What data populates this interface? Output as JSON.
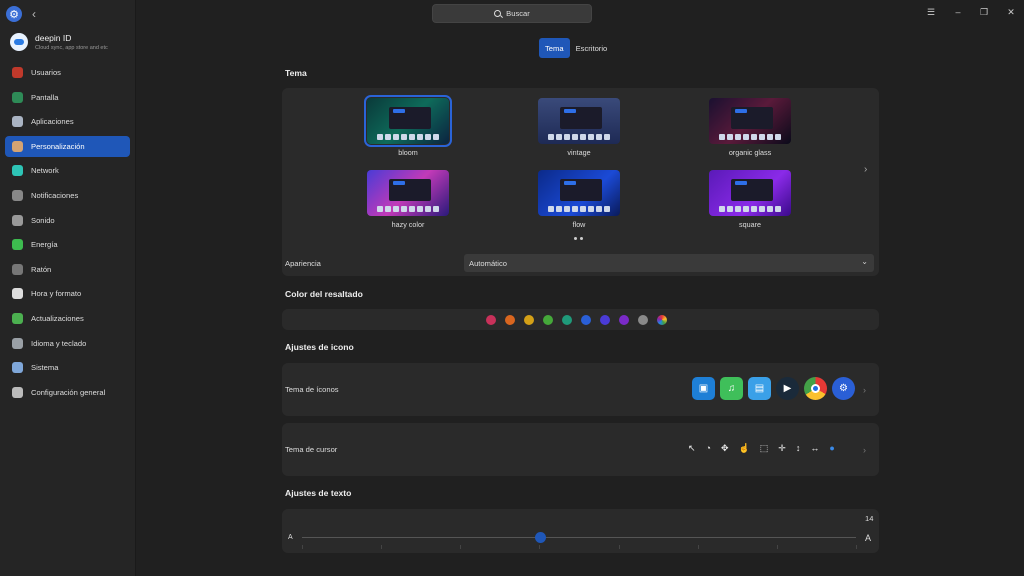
{
  "titlebar": {
    "search_label": "Buscar"
  },
  "account": {
    "name": "deepin ID",
    "subtitle": "Cloud sync, app store and etc"
  },
  "sidebar": {
    "items": [
      {
        "label": "Usuarios",
        "color": "#c0392b",
        "active": false
      },
      {
        "label": "Pantalla",
        "color": "#2e8b57",
        "active": false
      },
      {
        "label": "Aplicaciones",
        "color": "#aab4c3",
        "active": false
      },
      {
        "label": "Personalización",
        "color": "#d4a373",
        "active": true
      },
      {
        "label": "Network",
        "color": "#2ec4b6",
        "active": false
      },
      {
        "label": "Notificaciones",
        "color": "#888888",
        "active": false
      },
      {
        "label": "Sonido",
        "color": "#999999",
        "active": false
      },
      {
        "label": "Energía",
        "color": "#3dbb4f",
        "active": false
      },
      {
        "label": "Ratón",
        "color": "#777777",
        "active": false
      },
      {
        "label": "Hora y formato",
        "color": "#dddddd",
        "active": false
      },
      {
        "label": "Actualizaciones",
        "color": "#4cb050",
        "active": false
      },
      {
        "label": "Idioma y teclado",
        "color": "#9aa0a6",
        "active": false
      },
      {
        "label": "Sistema",
        "color": "#7fa7d9",
        "active": false
      },
      {
        "label": "Configuración general",
        "color": "#bbbbbb",
        "active": false
      }
    ]
  },
  "tabs": [
    {
      "label": "Tema",
      "active": true
    },
    {
      "label": "Escritorio",
      "active": false
    }
  ],
  "theme_section": {
    "title": "Tema",
    "themes": [
      {
        "name": "bloom",
        "selected": true,
        "bg": "linear-gradient(135deg,#0a3a3a,#0e6b5a 50%,#0b2340)"
      },
      {
        "name": "vintage",
        "selected": false,
        "bg": "linear-gradient(180deg,#3a4a7a,#1e2a55)"
      },
      {
        "name": "organic glass",
        "selected": false,
        "bg": "linear-gradient(135deg,#1a1030,#5a1a3a 50%,#0a0a1a)"
      },
      {
        "name": "hazy color",
        "selected": false,
        "bg": "linear-gradient(135deg,#4a3bd6,#c23ab8 50%,#2a1a7a)"
      },
      {
        "name": "flow",
        "selected": false,
        "bg": "linear-gradient(135deg,#0b2a8a,#1b4ad6 60%,#0a1a5a)"
      },
      {
        "name": "square",
        "selected": false,
        "bg": "linear-gradient(135deg,#5a1ab8,#8a2ae8 60%,#3a0a8a)"
      }
    ],
    "appearance_label": "Apariencia",
    "appearance_value": "Automático"
  },
  "accent_section": {
    "title": "Color del resaltado",
    "colors": [
      "#c8315a",
      "#d9661f",
      "#d4a017",
      "#45a83a",
      "#1f9a7a",
      "#2a5fd6",
      "#4a3bd6",
      "#7a2ac8",
      "#8a8a8a",
      "multicolor"
    ]
  },
  "icon_section": {
    "title": "Ajustes de icono",
    "icon_theme_label": "Tema de íconos",
    "icon_names": [
      "app-store-icon",
      "music-icon",
      "gallery-icon",
      "video-player-icon",
      "chrome-icon",
      "settings-icon"
    ],
    "cursor_label": "Tema de cursor",
    "cursor_names": [
      "arrow-cursor-icon",
      "busy-cursor-icon",
      "move-cursor-icon",
      "hand-cursor-icon",
      "resize-cursor-icon",
      "crosshair-cursor-icon",
      "vertical-resize-cursor-icon",
      "horizontal-resize-cursor-icon",
      "loading-cursor-icon"
    ]
  },
  "text_section": {
    "title": "Ajustes de texto",
    "font_size": "14",
    "font_size_fraction": 0.43,
    "small_a": "A",
    "large_a": "A"
  }
}
